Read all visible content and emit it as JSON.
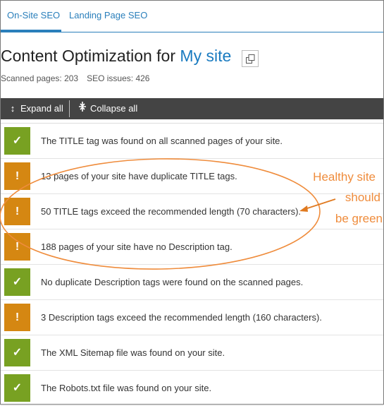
{
  "tabs": [
    {
      "label": "On-Site SEO",
      "active": true
    },
    {
      "label": "Landing Page SEO",
      "active": false
    }
  ],
  "header": {
    "title_prefix": "Content Optimization for ",
    "site_name": "My site",
    "copy_icon": "copy-icon",
    "scanned_pages": "Scanned pages: 203",
    "seo_issues": "SEO issues: 426"
  },
  "toolbar": {
    "expand_label": "Expand all",
    "expand_icon": "↕",
    "collapse_label": "Collapse all",
    "collapse_icon": "⤲"
  },
  "colors": {
    "accent": "#2a7fbb",
    "ok": "#78a122",
    "warning": "#d58712",
    "annotation": "#ef8c3c",
    "toolbar": "#444444"
  },
  "checks": [
    {
      "status": "ok",
      "icon": "✓",
      "text": "The TITLE tag was found on all scanned pages of your site."
    },
    {
      "status": "warn",
      "icon": "!",
      "text": "13 pages of your site have duplicate TITLE tags."
    },
    {
      "status": "warn",
      "icon": "!",
      "text": "50 TITLE tags exceed the recommended length (70 characters)."
    },
    {
      "status": "warn",
      "icon": "!",
      "text": "188 pages of your site have no Description tag."
    },
    {
      "status": "ok",
      "icon": "✓",
      "text": "No duplicate Description tags were found on the scanned pages."
    },
    {
      "status": "warn",
      "icon": "!",
      "text": "3 Description tags exceed the recommended length (160 characters)."
    },
    {
      "status": "ok",
      "icon": "✓",
      "text": "The XML Sitemap file was found on your site."
    },
    {
      "status": "ok",
      "icon": "✓",
      "text": "The Robots.txt file was found on your site."
    }
  ],
  "annotation": {
    "line1": "Healthy site",
    "line2": "should",
    "line3": "be green"
  }
}
